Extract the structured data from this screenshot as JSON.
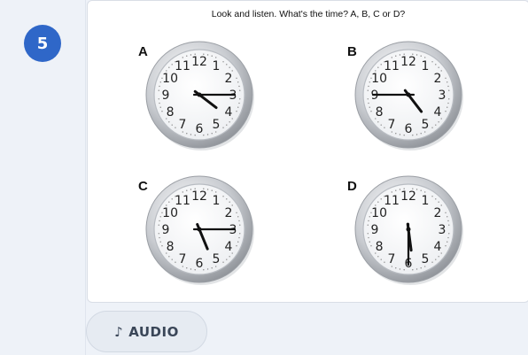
{
  "question": {
    "number": "5"
  },
  "exercise": {
    "instruction": "Look and listen. What's the time? A, B, C or D?",
    "options": [
      {
        "letter": "A",
        "hour_hand_deg": 127.5,
        "minute_hand_deg": 90
      },
      {
        "letter": "B",
        "hour_hand_deg": 142.5,
        "minute_hand_deg": 270
      },
      {
        "letter": "C",
        "hour_hand_deg": 157.5,
        "minute_hand_deg": 90
      },
      {
        "letter": "D",
        "hour_hand_deg": 172.5,
        "minute_hand_deg": 180
      }
    ],
    "clock_numerals": [
      "12",
      "1",
      "2",
      "3",
      "4",
      "5",
      "6",
      "7",
      "8",
      "9",
      "10",
      "11"
    ]
  },
  "audio_button": {
    "label": "AUDIO",
    "icon": "music-note-icon"
  }
}
